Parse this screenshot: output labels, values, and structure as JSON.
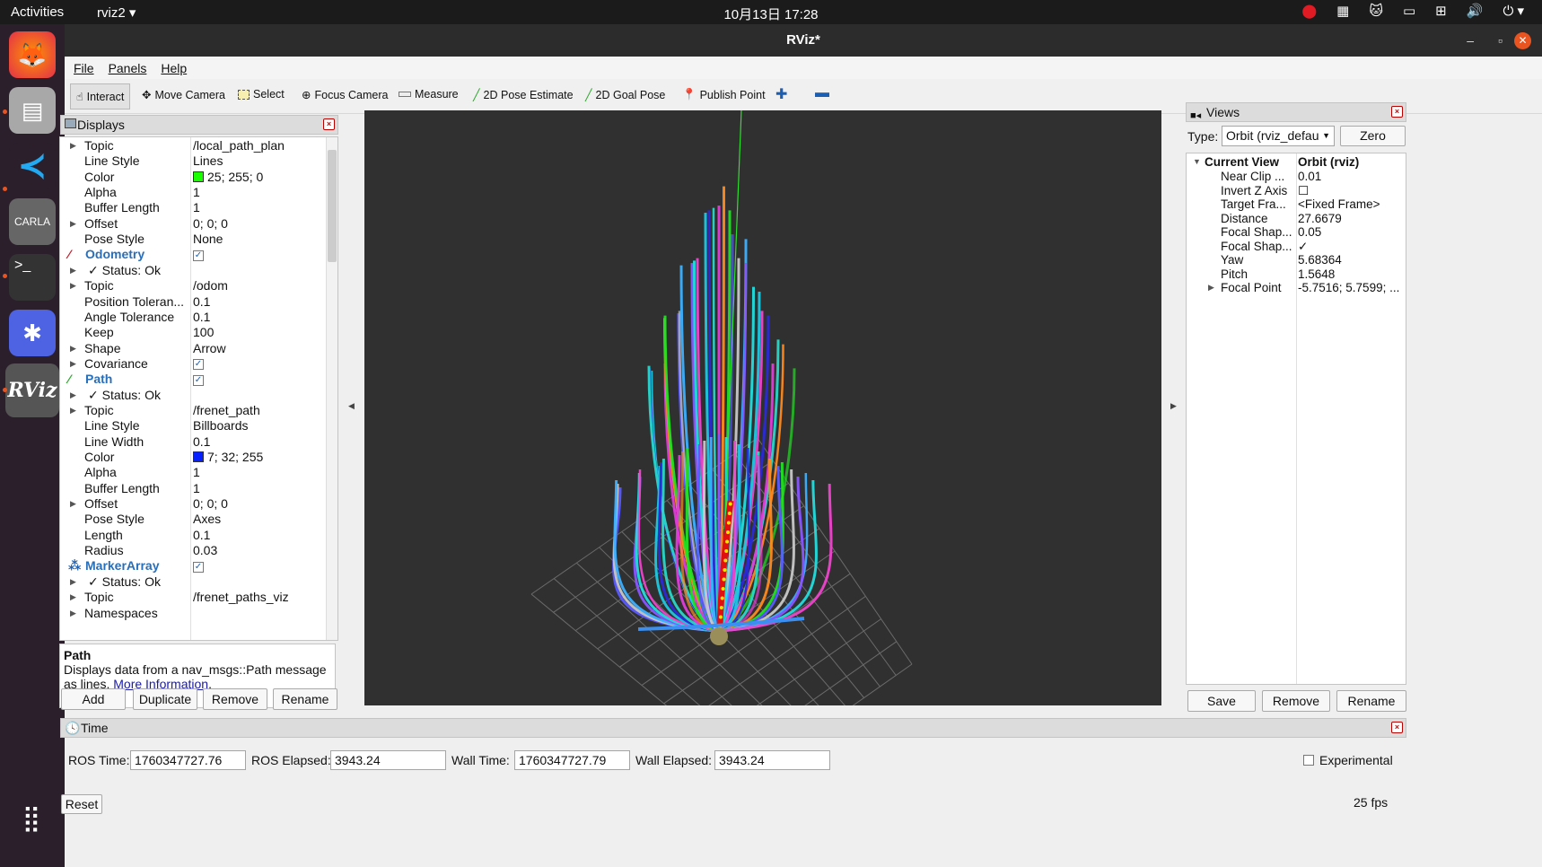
{
  "topbar": {
    "activities": "Activities",
    "app": "rviz2 ▾",
    "clock": "10月13日  17:28"
  },
  "window": {
    "title": "RViz*"
  },
  "menu": [
    "File",
    "Panels",
    "Help"
  ],
  "toolbar": {
    "interact": "Interact",
    "move_camera": "Move Camera",
    "select": "Select",
    "focus_camera": "Focus Camera",
    "measure": "Measure",
    "pose_estimate": "2D Pose Estimate",
    "goal_pose": "2D Goal Pose",
    "publish_point": "Publish Point"
  },
  "displays": {
    "title": "Displays",
    "rows": [
      {
        "name": "Topic",
        "value": "/local_path_plan",
        "arrow": true
      },
      {
        "name": "Line Style",
        "value": "Lines"
      },
      {
        "name": "Color",
        "value": "25; 255; 0",
        "swatch": "#19ff00"
      },
      {
        "name": "Alpha",
        "value": "1"
      },
      {
        "name": "Buffer Length",
        "value": "1"
      },
      {
        "name": "Offset",
        "value": "0; 0; 0",
        "arrow": true
      },
      {
        "name": "Pose Style",
        "value": "None"
      },
      {
        "name": "Odometry",
        "value": "✓",
        "header": true,
        "icon": "odometry-icon"
      },
      {
        "name": "✓  Status: Ok",
        "value": "",
        "arrow": true
      },
      {
        "name": "Topic",
        "value": "/odom",
        "arrow": true
      },
      {
        "name": "Position Toleran...",
        "value": "0.1"
      },
      {
        "name": "Angle Tolerance",
        "value": "0.1"
      },
      {
        "name": "Keep",
        "value": "100"
      },
      {
        "name": "Shape",
        "value": "Arrow",
        "arrow": true
      },
      {
        "name": "Covariance",
        "value": "✓",
        "arrow": true
      },
      {
        "name": "Path",
        "value": "✓",
        "header": true,
        "icon": "path-icon"
      },
      {
        "name": "✓  Status: Ok",
        "value": "",
        "arrow": true
      },
      {
        "name": "Topic",
        "value": "/frenet_path",
        "arrow": true
      },
      {
        "name": "Line Style",
        "value": "Billboards"
      },
      {
        "name": "Line Width",
        "value": "0.1"
      },
      {
        "name": "Color",
        "value": "7; 32; 255",
        "swatch": "#0720ff"
      },
      {
        "name": "Alpha",
        "value": "1"
      },
      {
        "name": "Buffer Length",
        "value": "1"
      },
      {
        "name": "Offset",
        "value": "0; 0; 0",
        "arrow": true
      },
      {
        "name": "Pose Style",
        "value": "Axes"
      },
      {
        "name": "Length",
        "value": "0.1"
      },
      {
        "name": "Radius",
        "value": "0.03"
      },
      {
        "name": "MarkerArray",
        "value": "✓",
        "header": true,
        "icon": "markerarray-icon"
      },
      {
        "name": "✓  Status: Ok",
        "value": "",
        "arrow": true
      },
      {
        "name": "Topic",
        "value": "/frenet_paths_viz",
        "arrow": true
      },
      {
        "name": "Namespaces",
        "value": "",
        "arrow": true
      }
    ]
  },
  "description": {
    "title": "Path",
    "text": "Displays data from a nav_msgs::Path message as lines. ",
    "link": "More Information",
    "end": "."
  },
  "display_buttons": [
    "Add",
    "Duplicate",
    "Remove",
    "Rename"
  ],
  "views": {
    "title": "Views",
    "type_label": "Type:",
    "type_value": "Orbit (rviz_defau",
    "zero": "Zero",
    "header": {
      "name": "Current View",
      "value": "Orbit (rviz)"
    },
    "rows": [
      {
        "name": "Near Clip ...",
        "value": "0.01"
      },
      {
        "name": "Invert Z Axis",
        "value": "☐"
      },
      {
        "name": "Target Fra...",
        "value": "<Fixed Frame>"
      },
      {
        "name": "Distance",
        "value": "27.6679"
      },
      {
        "name": "Focal Shap...",
        "value": "0.05"
      },
      {
        "name": "Focal Shap...",
        "value": "✓"
      },
      {
        "name": "Yaw",
        "value": "5.68364"
      },
      {
        "name": "Pitch",
        "value": "1.5648"
      },
      {
        "name": "Focal Point",
        "value": "-5.7516; 5.7599; ..."
      }
    ],
    "buttons": [
      "Save",
      "Remove",
      "Rename"
    ]
  },
  "time": {
    "title": "Time",
    "ros_time_label": "ROS Time:",
    "ros_time": "1760347727.76",
    "ros_elapsed_label": "ROS Elapsed:",
    "ros_elapsed": "3943.24",
    "wall_time_label": "Wall Time:",
    "wall_time": "1760347727.79",
    "wall_elapsed_label": "Wall Elapsed:",
    "wall_elapsed": "3943.24",
    "experimental": "Experimental",
    "reset": "Reset",
    "fps": "25 fps"
  }
}
